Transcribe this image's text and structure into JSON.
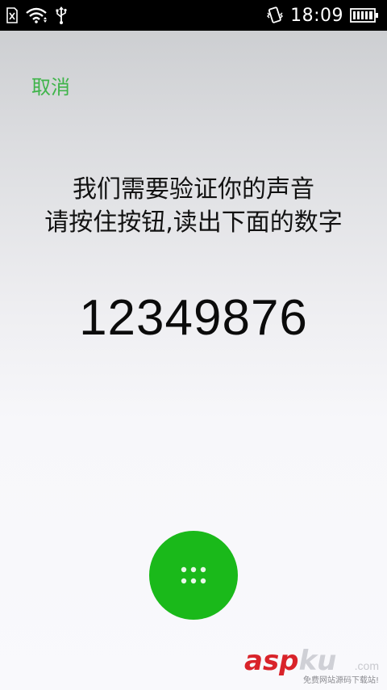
{
  "status_bar": {
    "time": "18:09",
    "icons": [
      "sim-slot-icon",
      "wifi-icon",
      "usb-icon",
      "vibrate-icon",
      "battery-icon"
    ]
  },
  "cancel_label": "取消",
  "prompt": {
    "line1": "我们需要验证你的声音",
    "line2": "请按住按钮,读出下面的数字"
  },
  "digits": "12349876",
  "record_button": {
    "icon": "keypad-dots-icon",
    "color": "#1ab91a"
  },
  "accent_color": "#3fb44a",
  "watermark": {
    "brand_a": "asp",
    "brand_b": "ku",
    "suffix": ".com",
    "subtitle": "免费网站源码下载站!"
  }
}
